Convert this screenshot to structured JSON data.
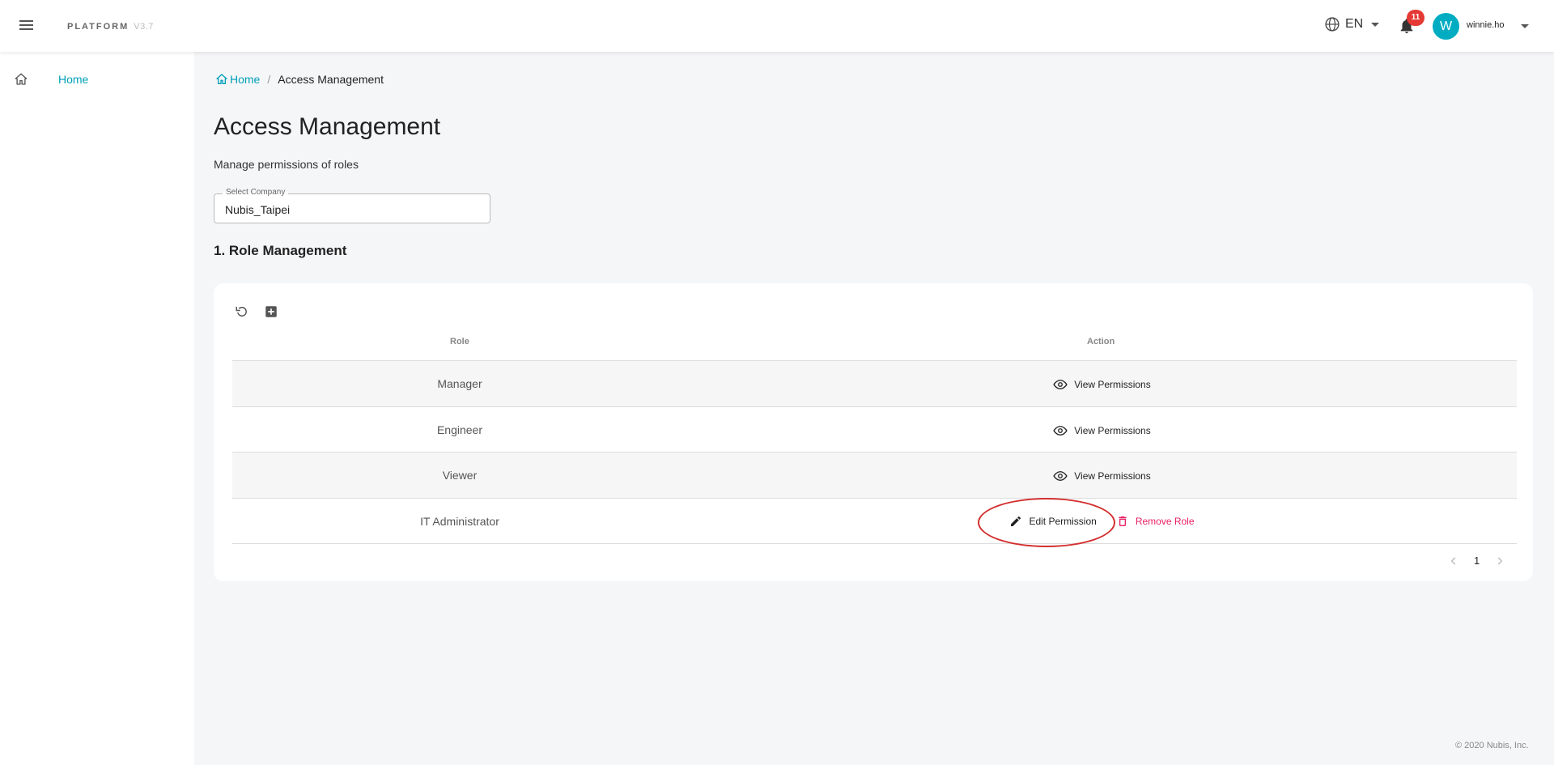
{
  "header": {
    "brand": "PLATFORM",
    "version": "V3.7",
    "language": "EN",
    "notification_count": "11",
    "avatar_letter": "W",
    "username": "winnie.ho"
  },
  "sidebar": {
    "items": [
      {
        "label": "Home",
        "icon": "home-icon"
      }
    ]
  },
  "breadcrumb": {
    "home": "Home",
    "separator": "/",
    "current": "Access Management"
  },
  "page": {
    "title": "Access Management",
    "subtitle": "Manage permissions of roles"
  },
  "company_select": {
    "label": "Select Company",
    "value": "Nubis_Taipei"
  },
  "role_section": {
    "title": "1. Role Management",
    "columns": {
      "role": "Role",
      "action": "Action"
    },
    "rows": [
      {
        "role": "Manager",
        "action": "View Permissions"
      },
      {
        "role": "Engineer",
        "action": "View Permissions"
      },
      {
        "role": "Viewer",
        "action": "View Permissions"
      },
      {
        "role": "IT Administrator",
        "edit": "Edit Permission",
        "remove": "Remove Role"
      }
    ],
    "pagination": {
      "current_page": "1"
    }
  },
  "footer": {
    "copyright": "© 2020 Nubis, Inc."
  },
  "colors": {
    "accent": "#00a0b8",
    "danger": "#e91e63",
    "badge": "#e53935",
    "avatar": "#00acc1",
    "highlight": "#d32f2f"
  }
}
